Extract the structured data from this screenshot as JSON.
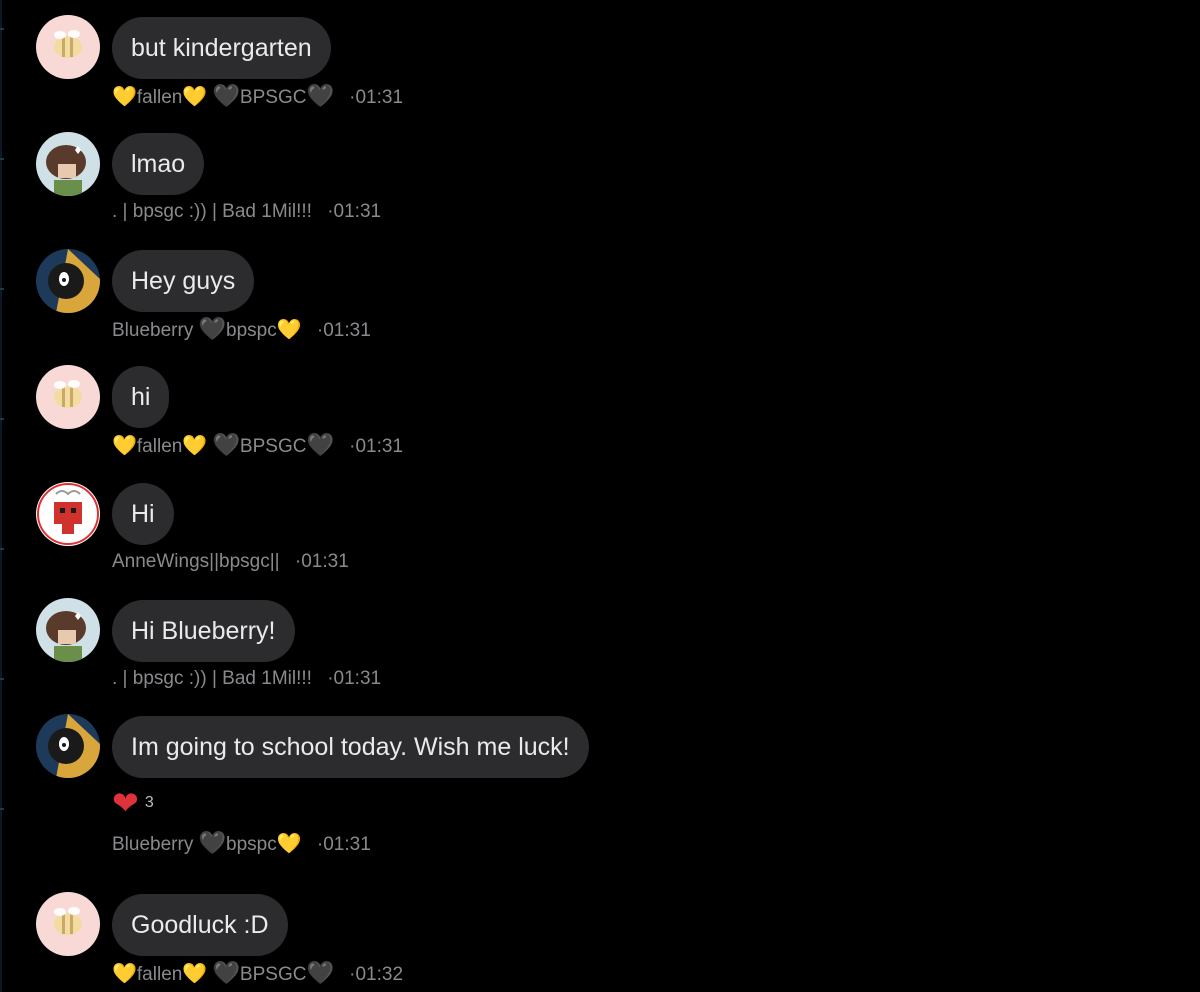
{
  "messages": [
    {
      "text": "but kindergarten",
      "name": "fallen",
      "name2": "BPSGC",
      "style": "fallen",
      "time": "01:31"
    },
    {
      "text": "lmao",
      "name": ". | bpsgc :)) | Bad 1Mil!!!",
      "style": "plain",
      "time": "01:31"
    },
    {
      "text": "Hey guys",
      "name": "Blueberry",
      "name2": "bpspc",
      "style": "blueberry",
      "time": "01:31"
    },
    {
      "text": "hi",
      "name": "fallen",
      "name2": "BPSGC",
      "style": "fallen",
      "time": "01:31"
    },
    {
      "text": "Hi",
      "name": "AnneWings||bpsgc||",
      "style": "plain",
      "time": "01:31"
    },
    {
      "text": "Hi Blueberry!",
      "name": ". | bpsgc :)) | Bad 1Mil!!!",
      "style": "plain",
      "time": "01:31"
    },
    {
      "text": "Im going to school today. Wish me luck!",
      "name": "Blueberry",
      "name2": "bpspc",
      "style": "blueberry",
      "time": "01:31",
      "reaction_count": "3"
    },
    {
      "text": "Goodluck :D",
      "name": "fallen",
      "name2": "BPSGC",
      "style": "fallen",
      "time": "01:32"
    }
  ],
  "icons": {
    "heart_gold": "💛",
    "heart_black": "🖤",
    "heart_red": "❤",
    "dot": "·"
  }
}
